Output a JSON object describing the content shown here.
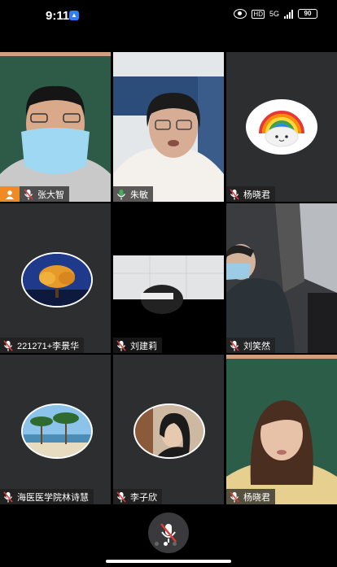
{
  "status": {
    "time": "9:11",
    "network_type": "5G",
    "hd": "HD",
    "battery": "90"
  },
  "participants": [
    {
      "name": "张大智",
      "host": true
    },
    {
      "name": "朱敏",
      "active_speaker": true
    },
    {
      "name": "杨晓君"
    },
    {
      "name": "221271+李景华"
    },
    {
      "name": "刘建莉"
    },
    {
      "name": "刘笑然"
    },
    {
      "name": "海医医学院林诗慧"
    },
    {
      "name": "李子欣"
    },
    {
      "name": "杨晓君"
    }
  ],
  "controls": {
    "mic_state": "muted",
    "page_dots": 3,
    "current_page": 2
  }
}
